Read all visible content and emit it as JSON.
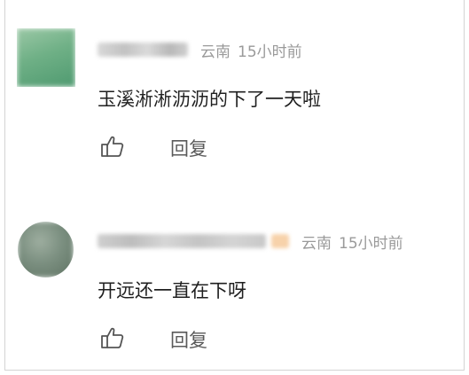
{
  "comments": [
    {
      "location": "云南",
      "time": "15小时前",
      "content": "玉溪淅淅沥沥的下了一天啦",
      "reply_label": "回复"
    },
    {
      "location": "云南",
      "time": "15小时前",
      "content": "开远还一直在下呀",
      "reply_label": "回复"
    }
  ],
  "colors": {
    "meta_text": "#9a9a9a",
    "content_text": "#1f1f1f",
    "action_text": "#5a5a5a"
  },
  "icons": {
    "like": "thumbs-up-outline"
  }
}
